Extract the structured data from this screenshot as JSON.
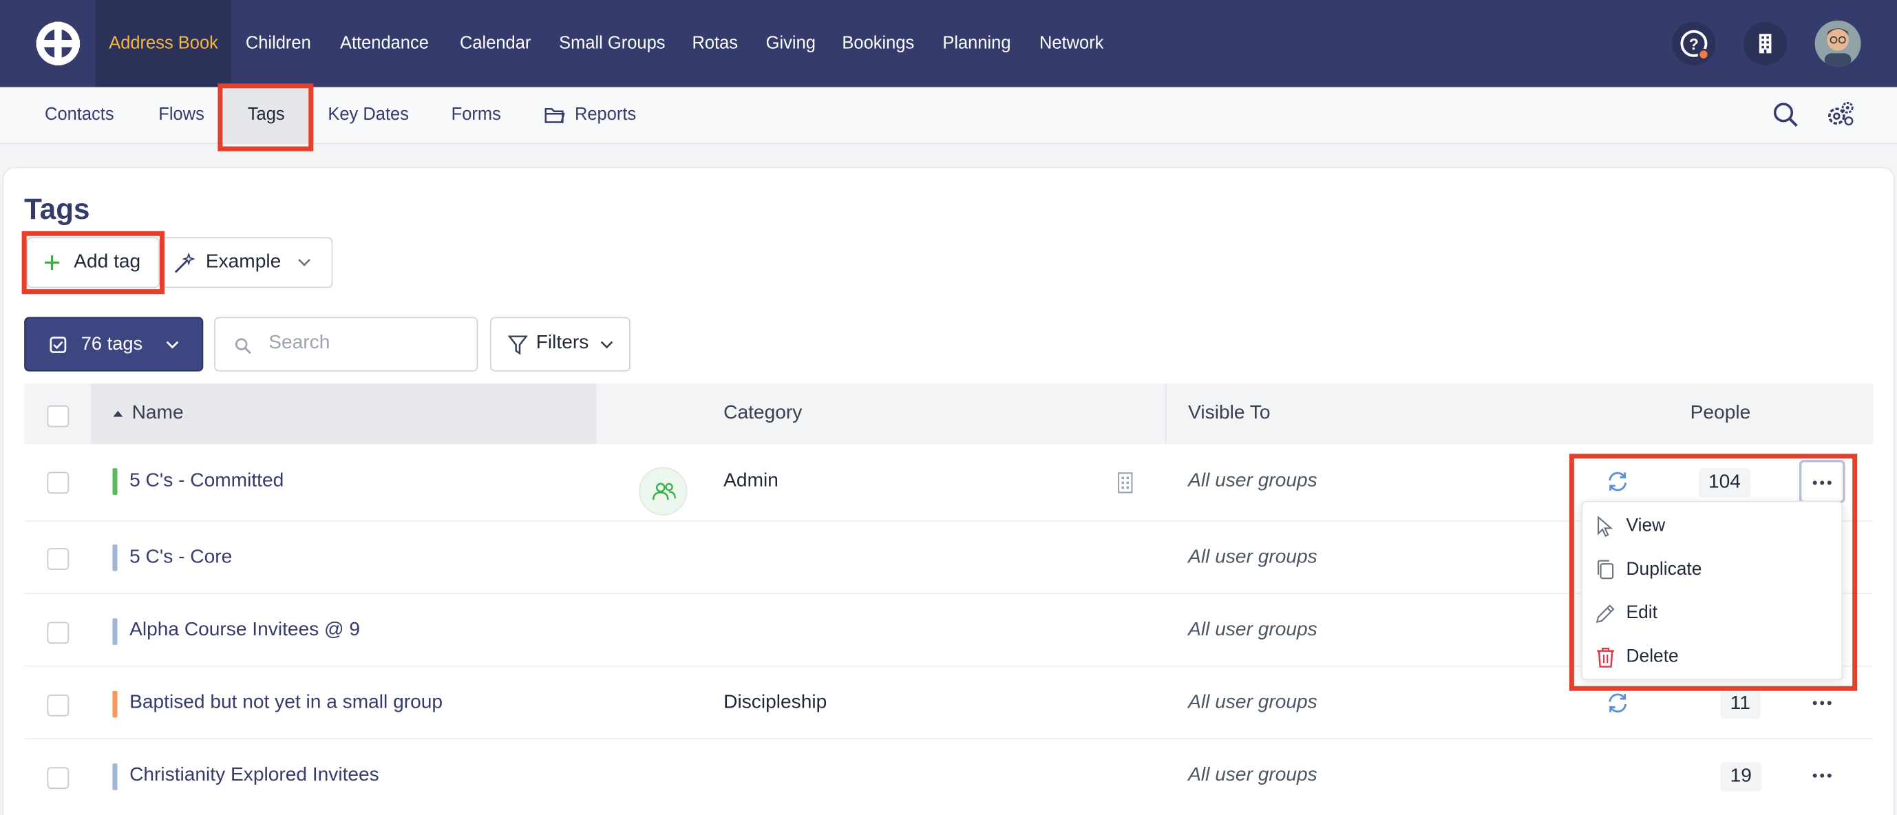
{
  "topnav": {
    "items": [
      {
        "label": "Address Book",
        "active": true
      },
      {
        "label": "Children"
      },
      {
        "label": "Attendance"
      },
      {
        "label": "Calendar"
      },
      {
        "label": "Small Groups"
      },
      {
        "label": "Rotas"
      },
      {
        "label": "Giving"
      },
      {
        "label": "Bookings"
      },
      {
        "label": "Planning"
      },
      {
        "label": "Network"
      }
    ],
    "icons": [
      "logo-icon",
      "help-icon",
      "building-icon",
      "avatar"
    ]
  },
  "subnav": {
    "items": [
      {
        "label": "Contacts"
      },
      {
        "label": "Flows"
      },
      {
        "label": "Tags",
        "active": true
      },
      {
        "label": "Key Dates"
      },
      {
        "label": "Forms"
      },
      {
        "label": "Reports",
        "icon": "folder-icon"
      }
    ],
    "icons": [
      "search-icon",
      "settings-icon"
    ]
  },
  "page": {
    "title": "Tags",
    "add_tag_label": "Add tag",
    "example_label": "Example",
    "tags_count_label": "76 tags",
    "search_placeholder": "Search",
    "filters_label": "Filters"
  },
  "table": {
    "headers": {
      "name": "Name",
      "category": "Category",
      "visible_to": "Visible To",
      "people": "People"
    },
    "sort": {
      "column": "Name",
      "direction": "ascending"
    },
    "rows": [
      {
        "name": "5 C's - Committed",
        "color": "#5cb85c",
        "category": "Admin",
        "visible_to": "All user groups",
        "people": "104",
        "sync": true,
        "people_icon": true,
        "building_icon": true
      },
      {
        "name": "5 C's - Core",
        "color": "#9fb6d6",
        "category": "",
        "visible_to": "All user groups",
        "people": ""
      },
      {
        "name": "Alpha Course Invitees @ 9",
        "color": "#9fb6d6",
        "category": "",
        "visible_to": "All user groups",
        "people": ""
      },
      {
        "name": "Baptised but not yet in a small group",
        "color": "#f0995a",
        "category": "Discipleship",
        "visible_to": "All user groups",
        "people": "11",
        "sync": true
      },
      {
        "name": "Christianity Explored Invitees",
        "color": "#9fb6d6",
        "category": "",
        "visible_to": "All user groups",
        "people": "19"
      }
    ]
  },
  "row_menu": {
    "items": [
      {
        "label": "View",
        "icon": "pointer-icon"
      },
      {
        "label": "Duplicate",
        "icon": "copy-icon"
      },
      {
        "label": "Edit",
        "icon": "pencil-icon"
      },
      {
        "label": "Delete",
        "icon": "trash-icon"
      }
    ]
  },
  "colors": {
    "nav_bg": "#353c6b",
    "nav_active_text": "#f5b73b",
    "accent": "#3d4680",
    "highlight": "#e5402b",
    "delete": "#dc3545"
  }
}
